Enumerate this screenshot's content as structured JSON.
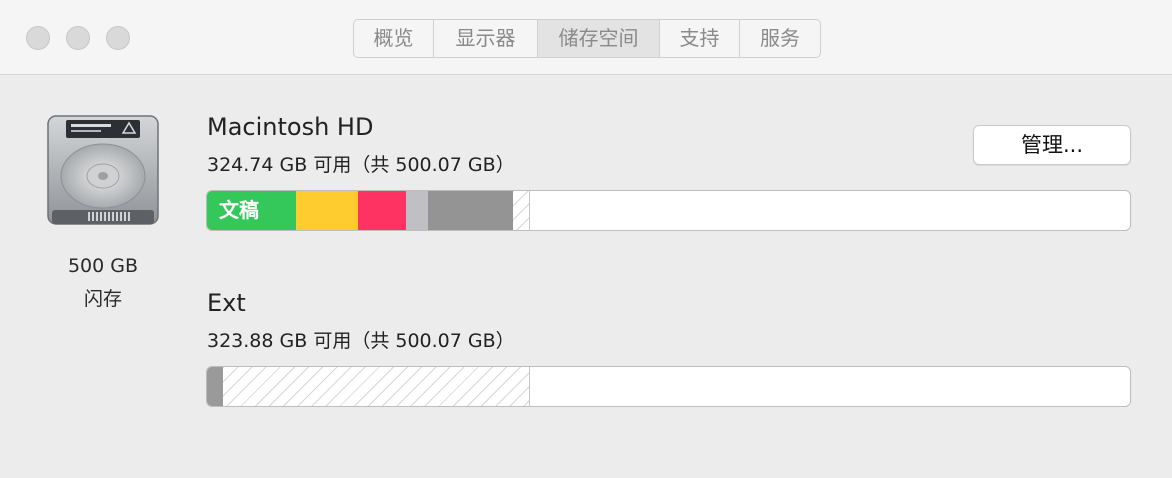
{
  "window": {
    "tabs": [
      {
        "label": "概览",
        "active": false
      },
      {
        "label": "显示器",
        "active": false
      },
      {
        "label": "储存空间",
        "active": true
      },
      {
        "label": "支持",
        "active": false
      },
      {
        "label": "服务",
        "active": false
      }
    ]
  },
  "disk": {
    "capacity": "500 GB",
    "type": "闪存",
    "icon": "hard-drive-icon"
  },
  "volumes": [
    {
      "name": "Macintosh HD",
      "summary": "324.74 GB 可用（共 500.07 GB）",
      "manage_label": "管理...",
      "usage_segments": [
        {
          "label": "文稿",
          "color": "#34c759"
        },
        {
          "label": "",
          "color": "#ffcc30"
        },
        {
          "label": "",
          "color": "#fe3361"
        },
        {
          "label": "",
          "color": "#c0bfc3"
        },
        {
          "label": "",
          "color": "#949494"
        }
      ]
    },
    {
      "name": "Ext",
      "summary": "323.88 GB 可用（共 500.07 GB）",
      "usage_segments": [
        {
          "label": "",
          "color": "#9a9a9a"
        }
      ]
    }
  ],
  "colors": {
    "window_bg": "#ececec",
    "titlebar_bg": "#f5f5f5"
  }
}
